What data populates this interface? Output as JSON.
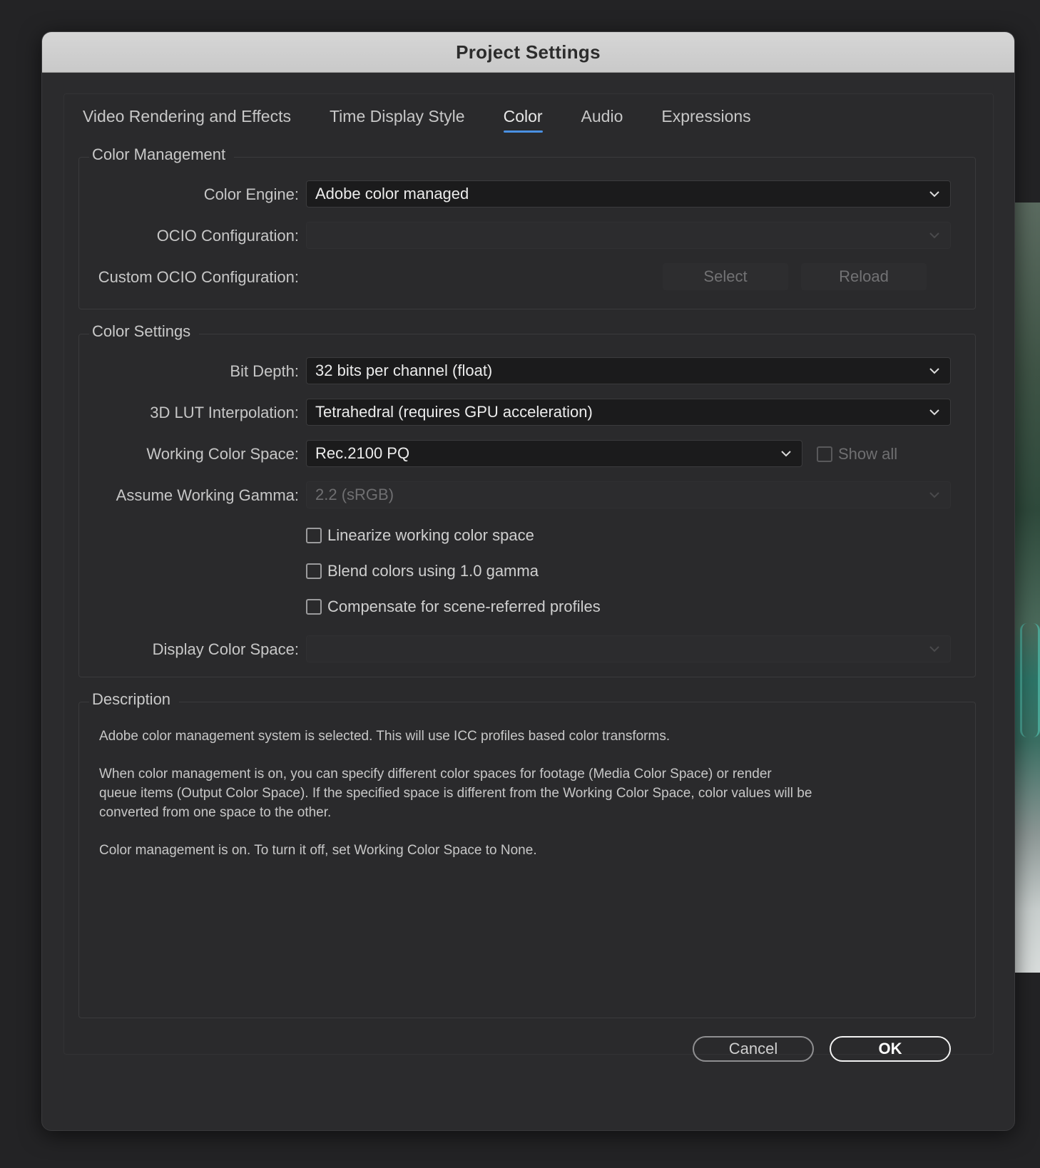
{
  "window": {
    "title": "Project Settings"
  },
  "tabs": [
    {
      "label": "Video Rendering and Effects"
    },
    {
      "label": "Time Display Style"
    },
    {
      "label": "Color",
      "active": true
    },
    {
      "label": "Audio"
    },
    {
      "label": "Expressions"
    }
  ],
  "color_management": {
    "title": "Color Management",
    "color_engine": {
      "label": "Color Engine:",
      "value": "Adobe color managed"
    },
    "ocio_configuration": {
      "label": "OCIO Configuration:",
      "value": ""
    },
    "custom_ocio": {
      "label": "Custom OCIO Configuration:",
      "select_label": "Select",
      "reload_label": "Reload"
    }
  },
  "color_settings": {
    "title": "Color Settings",
    "bit_depth": {
      "label": "Bit Depth:",
      "value": "32 bits per channel (float)"
    },
    "lut_interpolation": {
      "label": "3D LUT Interpolation:",
      "value": "Tetrahedral (requires GPU acceleration)"
    },
    "working_color_space": {
      "label": "Working Color Space:",
      "value": "Rec.2100 PQ",
      "show_all_label": "Show all",
      "show_all_checked": false
    },
    "assume_working_gamma": {
      "label": "Assume Working Gamma:",
      "value": "2.2 (sRGB)"
    },
    "linearize": {
      "label": "Linearize working color space",
      "checked": false
    },
    "blend_gamma": {
      "label": "Blend colors using 1.0 gamma",
      "checked": false
    },
    "compensate": {
      "label": "Compensate for scene-referred profiles",
      "checked": false
    },
    "display_color_space": {
      "label": "Display Color Space:",
      "value": ""
    }
  },
  "description": {
    "title": "Description",
    "p1": "Adobe color management system is selected. This will use ICC profiles based color transforms.",
    "p2": "When color management is on, you can specify different color spaces for footage (Media Color Space) or render queue items (Output Color Space). If the specified space is different from the Working Color Space, color values will be converted from one space to the other.",
    "p3": "Color management is on. To turn it off, set Working Color Space to None."
  },
  "buttons": {
    "cancel": "Cancel",
    "ok": "OK"
  },
  "colors": {
    "accent": "#4a90e2",
    "dialog_bg": "#2b2b2d",
    "titlebar": "#cfcfcf"
  }
}
